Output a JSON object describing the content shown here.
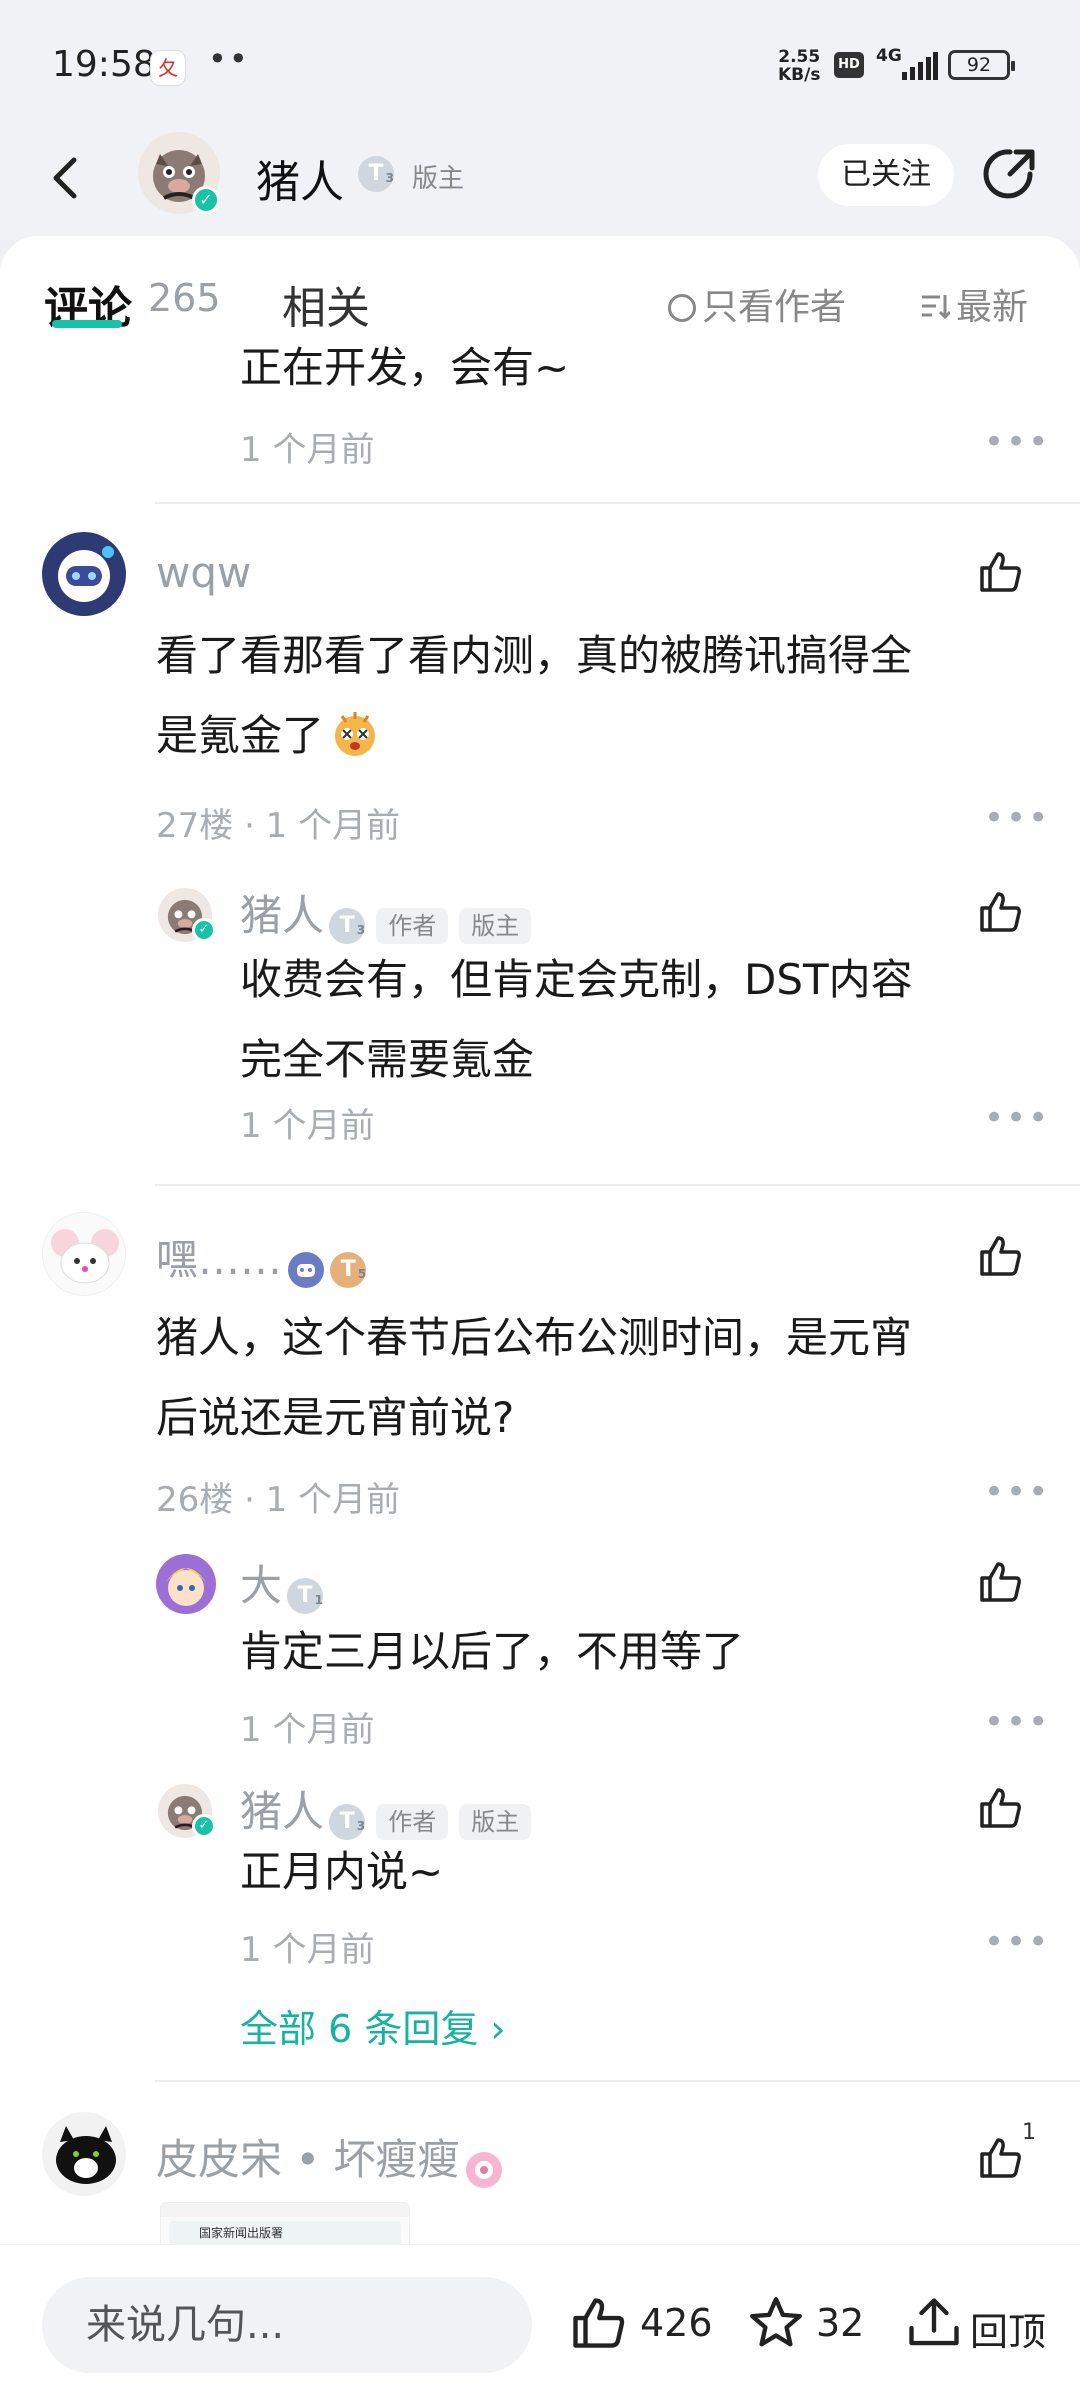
{
  "status": {
    "time": "19:58",
    "app_badge": "夂",
    "dots": "••",
    "net_speed_value": "2.55",
    "net_speed_unit": "KB/s",
    "hd": "HD",
    "network": "4G",
    "battery": "92"
  },
  "header": {
    "name": "猪人",
    "level": "T",
    "level_sub": "3",
    "role": "版主",
    "follow_label": "已关注"
  },
  "tabs": {
    "comments_label": "评论",
    "comments_count": "265",
    "related_label": "相关",
    "only_author_label": "只看作者",
    "sort_label": "最新"
  },
  "comments": [
    {
      "partial_text": "正在开发，会有~",
      "time": "1 个月前"
    },
    {
      "user": "wqw",
      "text_line1": "看了看那看了看内测，真的被腾讯搞得全",
      "text_line2": "是氪金了",
      "floor_time": "27楼 · 1 个月前",
      "replies": [
        {
          "user": "猪人",
          "level": "T",
          "level_sub": "3",
          "tag1": "作者",
          "tag2": "版主",
          "text_line1": "收费会有，但肯定会克制，DST内容",
          "text_line2": "完全不需要氪金",
          "time": "1 个月前"
        }
      ]
    },
    {
      "user": "嘿……",
      "badge_level": "T",
      "badge_level_sub": "5",
      "text_line1": "猪人，这个春节后公布公测时间，是元宵",
      "text_line2": "后说还是元宵前说?",
      "floor_time": "26楼 · 1 个月前",
      "replies": [
        {
          "user": "大",
          "level": "T",
          "level_sub": "1",
          "text": "肯定三月以后了，不用等了",
          "time": "1 个月前"
        },
        {
          "user": "猪人",
          "level": "T",
          "level_sub": "3",
          "tag1": "作者",
          "tag2": "版主",
          "text": "正月内说~",
          "time": "1 个月前"
        }
      ],
      "more_replies": "全部 6 条回复 ›"
    },
    {
      "user": "皮皮宋 • 坏瘦瘦",
      "like_count": "1",
      "thumb_line1": "国家新闻出版署"
    }
  ],
  "more_label": "•••",
  "bottom": {
    "placeholder": "来说几句...",
    "likes": "426",
    "favorites": "32",
    "top_label": "回顶"
  },
  "colors": {
    "accent": "#17c3a8",
    "gray_text": "#a8adb3"
  }
}
